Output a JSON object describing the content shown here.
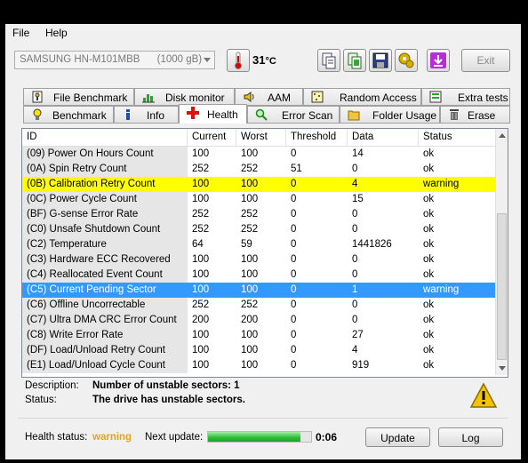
{
  "menu": {
    "file": "File",
    "help": "Help"
  },
  "toolbar": {
    "drive": "SAMSUNG HN-M101MBB      (1000 gB)",
    "temperature": "31",
    "temperature_unit": "°C",
    "exit_label": "Exit",
    "icons": [
      "thermometer-icon",
      "copy-icon",
      "copy-all-icon",
      "save-icon",
      "options-icon",
      "download-icon"
    ]
  },
  "tabs_top": [
    "File Benchmark",
    "Disk monitor",
    "AAM",
    "Random Access",
    "Extra tests"
  ],
  "tabs_bottom": [
    "Benchmark",
    "Info",
    "Health",
    "Error Scan",
    "Folder Usage",
    "Erase"
  ],
  "active_tab": "Health",
  "grid": {
    "columns": [
      "ID",
      "Current",
      "Worst",
      "Threshold",
      "Data",
      "Status"
    ],
    "rows": [
      [
        "(09) Power On Hours Count",
        "100",
        "100",
        "0",
        "14",
        "ok"
      ],
      [
        "(0A) Spin Retry Count",
        "252",
        "252",
        "51",
        "0",
        "ok"
      ],
      [
        "(0B) Calibration Retry Count",
        "100",
        "100",
        "0",
        "4",
        "warning"
      ],
      [
        "(0C) Power Cycle Count",
        "100",
        "100",
        "0",
        "15",
        "ok"
      ],
      [
        "(BF) G-sense Error Rate",
        "252",
        "252",
        "0",
        "0",
        "ok"
      ],
      [
        "(C0) Unsafe Shutdown Count",
        "252",
        "252",
        "0",
        "0",
        "ok"
      ],
      [
        "(C2) Temperature",
        "64",
        "59",
        "0",
        "1441826",
        "ok"
      ],
      [
        "(C3) Hardware ECC Recovered",
        "100",
        "100",
        "0",
        "0",
        "ok"
      ],
      [
        "(C4) Reallocated Event Count",
        "100",
        "100",
        "0",
        "0",
        "ok"
      ],
      [
        "(C5) Current Pending Sector",
        "100",
        "100",
        "0",
        "1",
        "warning"
      ],
      [
        "(C6) Offline Uncorrectable",
        "252",
        "252",
        "0",
        "0",
        "ok"
      ],
      [
        "(C7) Ultra DMA CRC Error Count",
        "200",
        "200",
        "0",
        "0",
        "ok"
      ],
      [
        "(C8) Write Error Rate",
        "100",
        "100",
        "0",
        "27",
        "ok"
      ],
      [
        "(DF) Load/Unload Retry Count",
        "100",
        "100",
        "0",
        "4",
        "ok"
      ],
      [
        "(E1) Load/Unload Cycle Count",
        "100",
        "100",
        "0",
        "919",
        "ok"
      ]
    ],
    "highlight_yellow_row": 2,
    "selected_row": 9
  },
  "description": {
    "desc_label": "Description:",
    "desc_value": "Number of unstable sectors: 1",
    "status_label": "Status:",
    "status_value": "The drive has unstable sectors."
  },
  "statusbar": {
    "health_label": "Health status:",
    "health_value": "warning",
    "health_color": "#e8a317",
    "next_update_label": "Next update:",
    "progress": 0.9,
    "countdown": "0:06",
    "update_label": "Update",
    "log_label": "Log"
  }
}
